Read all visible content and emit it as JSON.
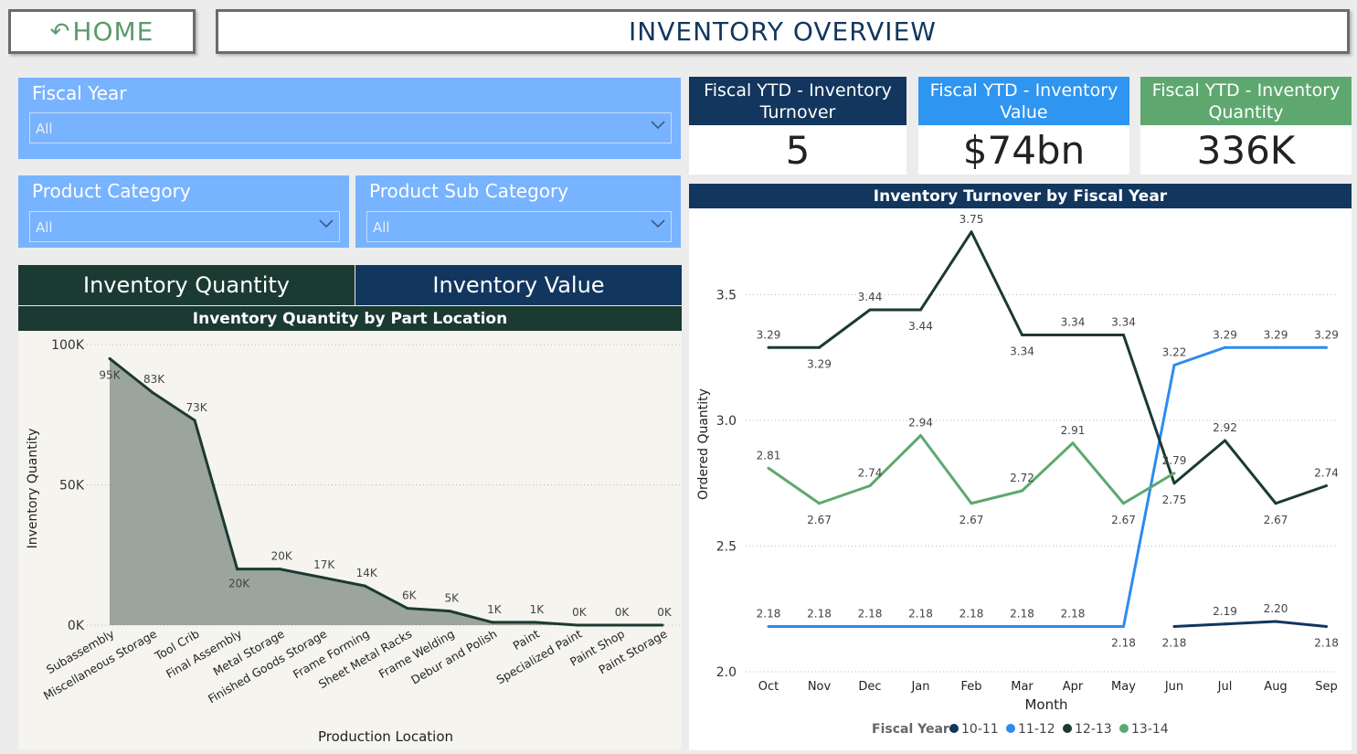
{
  "header": {
    "home_label": "HOME",
    "title": "INVENTORY OVERVIEW"
  },
  "filters": {
    "fiscal_year": {
      "label": "Fiscal Year",
      "value": "All"
    },
    "product_category": {
      "label": "Product Category",
      "value": "All"
    },
    "product_sub_category": {
      "label": "Product Sub Category",
      "value": "All"
    }
  },
  "kpis": [
    {
      "label": "Fiscal YTD - Inventory Turnover",
      "value": "5",
      "color": "#12365e"
    },
    {
      "label": "Fiscal YTD - Inventory Value",
      "value": "$74bn",
      "color": "#2e95f0"
    },
    {
      "label": "Fiscal YTD - Inventory Quantity",
      "value": "336K",
      "color": "#5ea870"
    }
  ],
  "tabs": {
    "quantity": "Inventory Quantity",
    "value": "Inventory Value"
  },
  "colors": {
    "dark_green": "#1b3a32",
    "navy": "#12365e",
    "slicer_blue": "#78b3ff",
    "area_fill": "#9ba49d"
  },
  "area_chart": {
    "title": "Inventory Quantity by Part Location",
    "chart_data": {
      "type": "area",
      "title": "Inventory Quantity by Part Location",
      "xlabel": "Production Location",
      "ylabel": "Inventory Quantity",
      "ylim": [
        0,
        100000
      ],
      "yticks": [
        "0K",
        "50K",
        "100K"
      ],
      "categories": [
        "Subassembly",
        "Miscellaneous Storage",
        "Tool Crib",
        "Final Assembly",
        "Metal Storage",
        "Finished Goods Storage",
        "Frame Forming",
        "Sheet Metal Racks",
        "Frame Welding",
        "Debur and Polish",
        "Paint",
        "Specialized Paint",
        "Paint Shop",
        "Paint Storage"
      ],
      "values": [
        95000,
        83000,
        73000,
        20000,
        20000,
        17000,
        14000,
        6000,
        5000,
        1000,
        1000,
        0,
        0,
        0
      ],
      "data_labels": [
        "95K",
        "83K",
        "73K",
        "20K",
        "20K",
        "17K",
        "14K",
        "6K",
        "5K",
        "1K",
        "1K",
        "0K",
        "0K",
        "0K"
      ],
      "grid": true
    }
  },
  "line_chart": {
    "title": "Inventory Turnover by Fiscal Year",
    "chart_data": {
      "type": "line",
      "title": "Inventory Turnover by Fiscal Year",
      "xlabel": "Month",
      "ylabel": "Ordered Quantity",
      "ylim": [
        2.0,
        3.8
      ],
      "yticks": [
        "2.0",
        "2.5",
        "3.0",
        "3.5"
      ],
      "categories": [
        "Oct",
        "Nov",
        "Dec",
        "Jan",
        "Feb",
        "Mar",
        "Apr",
        "May",
        "Jun",
        "Jul",
        "Aug",
        "Sep"
      ],
      "legend_title": "Fiscal Year",
      "legend_position": "bottom",
      "grid": true,
      "series": [
        {
          "name": "10-11",
          "color": "#12365e",
          "values": [
            null,
            null,
            null,
            null,
            null,
            null,
            null,
            null,
            2.18,
            2.19,
            2.2,
            2.18
          ]
        },
        {
          "name": "11-12",
          "color": "#2e8bf0",
          "values": [
            2.18,
            2.18,
            2.18,
            2.18,
            2.18,
            2.18,
            2.18,
            2.18,
            3.22,
            3.29,
            3.29,
            3.29
          ]
        },
        {
          "name": "12-13",
          "color": "#1b3a32",
          "values": [
            3.29,
            3.29,
            3.44,
            3.44,
            3.75,
            3.34,
            3.34,
            3.34,
            2.75,
            2.92,
            2.67,
            2.74
          ]
        },
        {
          "name": "13-14",
          "color": "#5ea870",
          "values": [
            2.81,
            2.67,
            2.74,
            2.94,
            2.67,
            2.72,
            2.91,
            2.67,
            2.79,
            null,
            null,
            null
          ]
        }
      ]
    }
  }
}
